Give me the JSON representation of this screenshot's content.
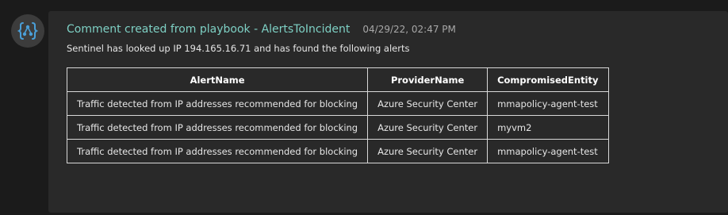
{
  "avatar": {
    "icon": "curly-braces-workflow-icon",
    "accent": "#4a9fd8"
  },
  "comment": {
    "title": "Comment created from playbook - AlertsToIncident",
    "timestamp": "04/29/22, 02:47 PM",
    "message": "Sentinel has looked up IP 194.165.16.71 and has found the following alerts"
  },
  "table": {
    "headers": [
      "AlertName",
      "ProviderName",
      "CompromisedEntity"
    ],
    "rows": [
      [
        "Traffic detected from IP addresses recommended for blocking",
        "Azure Security Center",
        "mmapolicy-agent-test"
      ],
      [
        "Traffic detected from IP addresses recommended for blocking",
        "Azure Security Center",
        "myvm2"
      ],
      [
        "Traffic detected from IP addresses recommended for blocking",
        "Azure Security Center",
        "mmapolicy-agent-test"
      ]
    ]
  },
  "colors": {
    "title": "#7ed0c4",
    "background": "#1b1b1b",
    "card": "#292929"
  }
}
